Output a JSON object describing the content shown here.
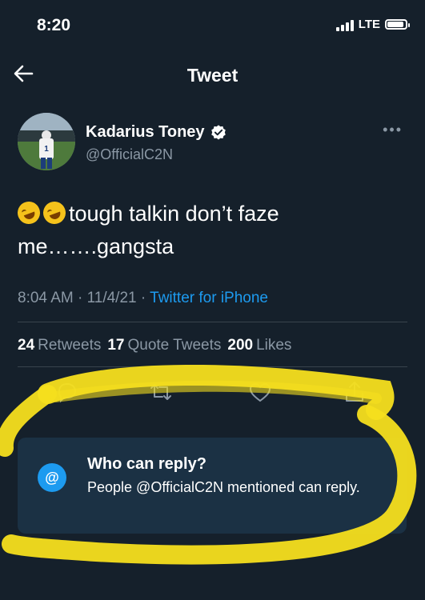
{
  "status_bar": {
    "time": "8:20",
    "network": "LTE"
  },
  "nav": {
    "title": "Tweet"
  },
  "tweet": {
    "author_name": "Kadarius Toney",
    "author_handle": "@OfficialC2N",
    "text": "tough talkin don’t faze me…….gangsta",
    "emoji": "🤣🤣",
    "time": "8:04 AM",
    "date": "11/4/21",
    "source": "Twitter for iPhone",
    "more_icon": "ellipsis-icon"
  },
  "stats": {
    "retweets_count": "24",
    "retweets_label": "Retweets",
    "quotes_count": "17",
    "quotes_label": "Quote Tweets",
    "likes_count": "200",
    "likes_label": "Likes"
  },
  "reply_settings": {
    "title": "Who can reply?",
    "body": "People @OfficialC2N mentioned can reply.",
    "icon_glyph": "@"
  },
  "colors": {
    "background": "#15202b",
    "accent": "#1d9bf0",
    "secondary_text": "#8b98a5",
    "card": "#1b3144",
    "highlight": "#f5df1e"
  }
}
